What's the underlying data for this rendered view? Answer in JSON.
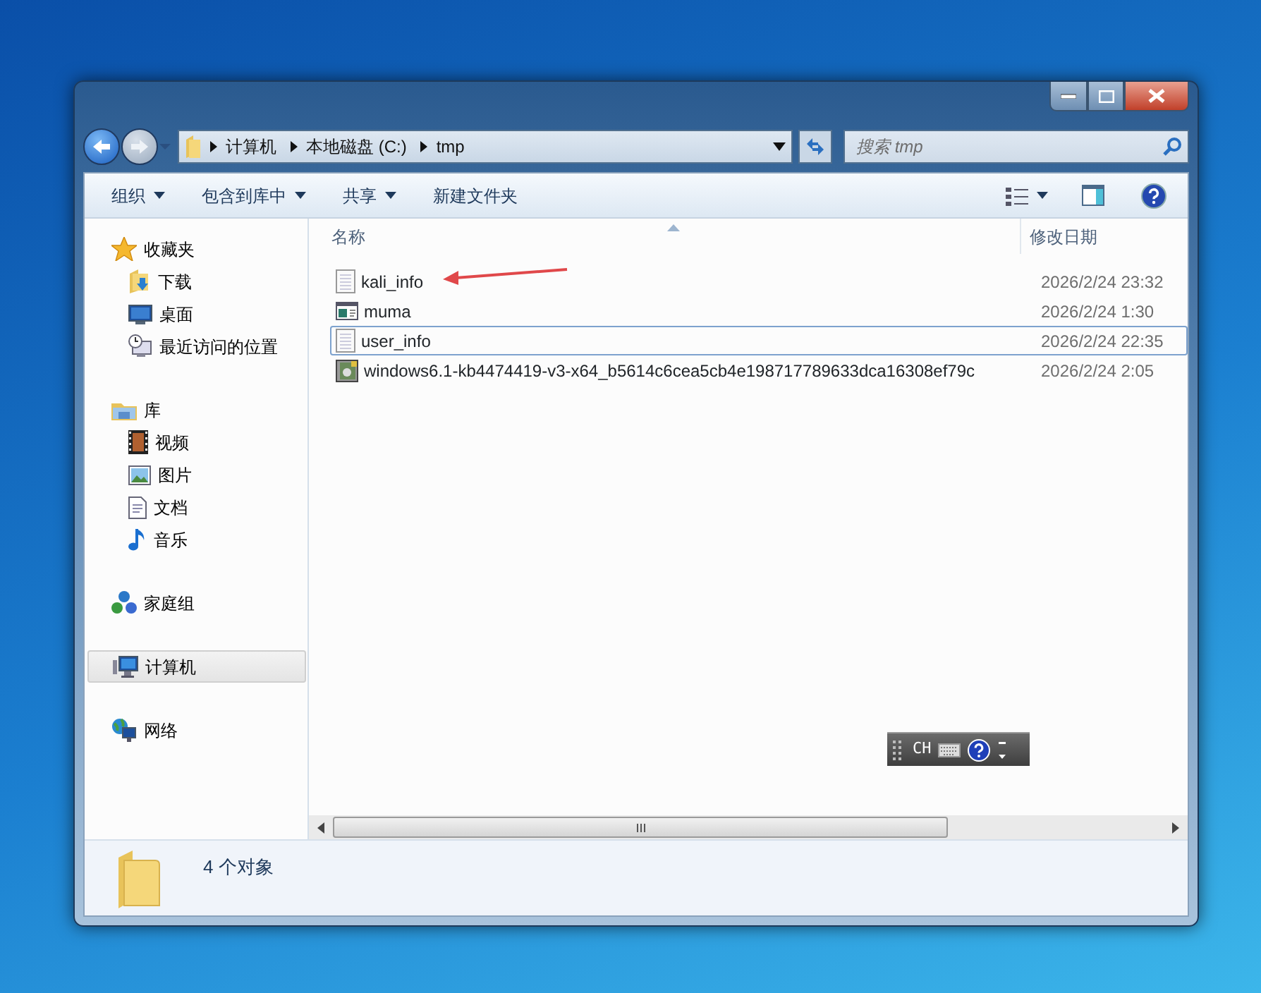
{
  "address": {
    "breadcrumbs": [
      "计算机",
      "本地磁盘 (C:)",
      "tmp"
    ]
  },
  "search": {
    "placeholder": "搜索 tmp"
  },
  "toolbar": {
    "buttons": [
      {
        "label": "组织",
        "dropdown": true
      },
      {
        "label": "包含到库中",
        "dropdown": true
      },
      {
        "label": "共享",
        "dropdown": true
      },
      {
        "label": "新建文件夹",
        "dropdown": false
      }
    ]
  },
  "navigation": [
    {
      "label": "收藏夹",
      "kind": "favorites",
      "selected": false,
      "children": [
        {
          "label": "下载",
          "kind": "downloads",
          "selected": false
        },
        {
          "label": "桌面",
          "kind": "desktop",
          "selected": false
        },
        {
          "label": "最近访问的位置",
          "kind": "recent",
          "selected": false
        }
      ]
    },
    {
      "label": "库",
      "kind": "libraries",
      "selected": false,
      "children": [
        {
          "label": "视频",
          "kind": "videos",
          "selected": false
        },
        {
          "label": "图片",
          "kind": "pictures",
          "selected": false
        },
        {
          "label": "文档",
          "kind": "documents",
          "selected": false
        },
        {
          "label": "音乐",
          "kind": "music",
          "selected": false
        }
      ]
    },
    {
      "label": "家庭组",
      "kind": "homegroup",
      "selected": false
    },
    {
      "label": "计算机",
      "kind": "computer",
      "selected": true
    },
    {
      "label": "网络",
      "kind": "network",
      "selected": false
    }
  ],
  "columns": [
    {
      "label": "名称",
      "sorted": true
    },
    {
      "label": "修改日期",
      "sorted": false
    }
  ],
  "files": [
    {
      "name": "kali_info",
      "modified": "2026/2/24 23:32",
      "kind": "text",
      "focused": false
    },
    {
      "name": "muma",
      "modified": "2026/2/24 1:30",
      "kind": "app",
      "focused": false
    },
    {
      "name": "user_info",
      "modified": "2026/2/24 22:35",
      "kind": "text",
      "focused": true
    },
    {
      "name": "windows6.1-kb4474419-v3-x64_b5614c6cea5cb4e198717789633dca16308ef79c",
      "modified": "2026/2/24 2:05",
      "kind": "package",
      "focused": false
    }
  ],
  "status_bar": {
    "count": "4 个对象"
  },
  "ime_bar": {
    "language": "CH"
  }
}
